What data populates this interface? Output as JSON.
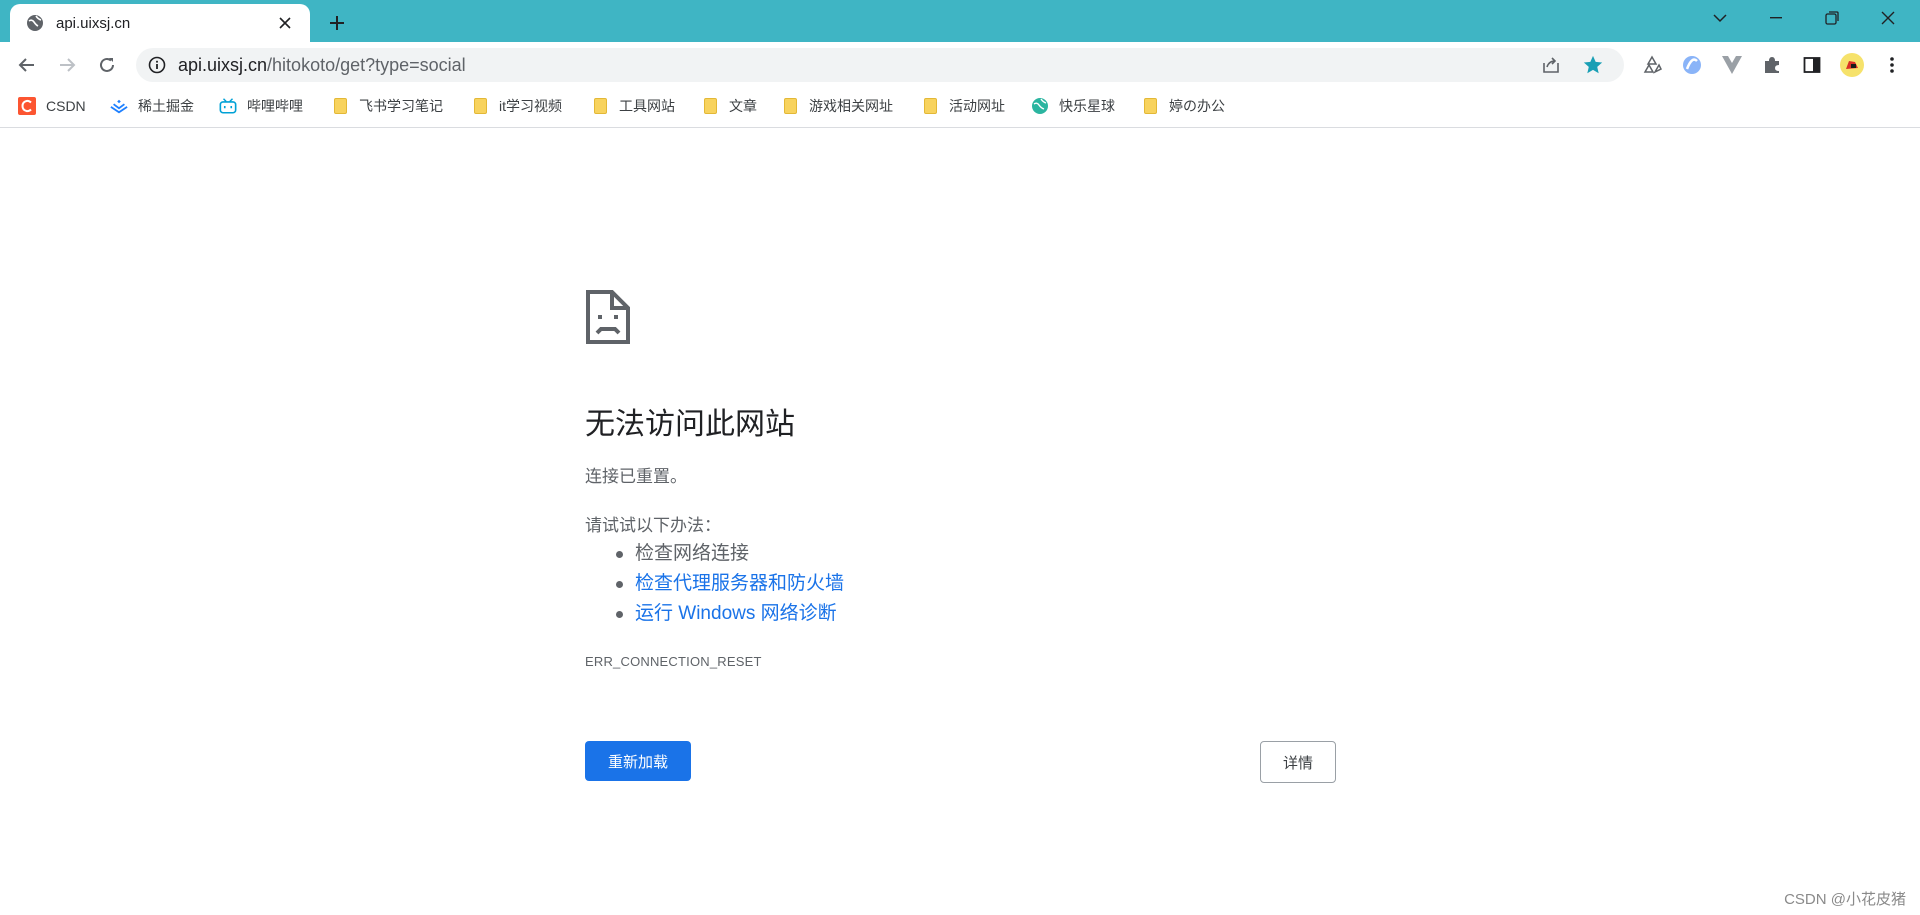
{
  "window": {
    "controls": [
      "chevron-down-icon",
      "minimize-icon",
      "restore-icon",
      "close-icon"
    ]
  },
  "tab": {
    "title": "api.uixsj.cn",
    "favicon": "globe-icon"
  },
  "toolbar": {
    "url_host": "api.uixsj.cn",
    "url_path": "/hitokoto/get?type=social",
    "accent_color": "#3fb5c4",
    "star_color": "#1a9fb5"
  },
  "bookmarks": [
    {
      "label": "CSDN",
      "icon": "csdn-icon"
    },
    {
      "label": "稀土掘金",
      "icon": "juejin-icon"
    },
    {
      "label": "哔哩哔哩",
      "icon": "bilibili-icon"
    },
    {
      "label": "飞书学习笔记",
      "icon": "folder-icon"
    },
    {
      "label": "it学习视频",
      "icon": "folder-icon"
    },
    {
      "label": "工具网站",
      "icon": "folder-icon"
    },
    {
      "label": "文章",
      "icon": "folder-icon"
    },
    {
      "label": "游戏相关网址",
      "icon": "folder-icon"
    },
    {
      "label": "活动网址",
      "icon": "folder-icon"
    },
    {
      "label": "快乐星球",
      "icon": "globe-icon"
    },
    {
      "label": "婷の办公",
      "icon": "folder-icon"
    }
  ],
  "error": {
    "title": "无法访问此网站",
    "summary": "连接已重置。",
    "suggestions_heading": "请试试以下办法：",
    "suggestions": [
      {
        "text": "检查网络连接",
        "is_link": false
      },
      {
        "text": "检查代理服务器和防火墙",
        "is_link": true
      },
      {
        "text": "运行 Windows 网络诊断",
        "is_link": true
      }
    ],
    "code": "ERR_CONNECTION_RESET",
    "reload_label": "重新加载",
    "details_label": "详情"
  },
  "watermark": "CSDN @小花皮猪"
}
